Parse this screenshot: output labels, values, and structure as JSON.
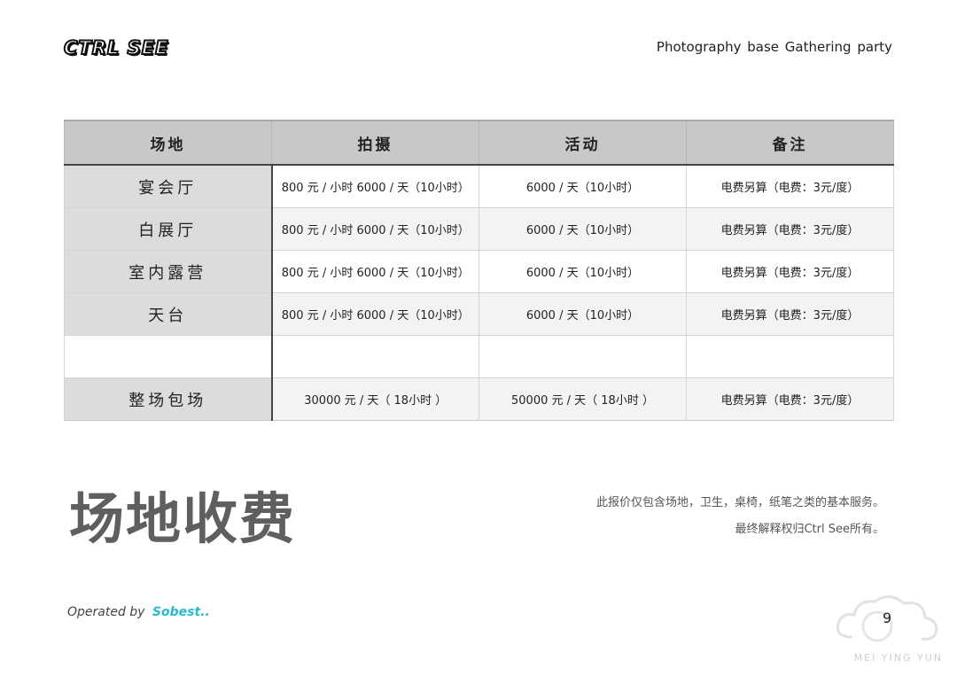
{
  "header": {
    "logo_text": "CTRL SEE",
    "tagline": "Photography base  Gathering party"
  },
  "table": {
    "columns": [
      "场地",
      "拍摄",
      "活动",
      "备注"
    ],
    "rows": [
      {
        "venue": "宴会厅",
        "shoot": "800 元 / 小时   6000 / 天（10小时）",
        "event": "6000 / 天（10小时）",
        "note": "电费另算（电费：3元/度）"
      },
      {
        "venue": "白展厅",
        "shoot": "800 元 / 小时   6000 / 天（10小时）",
        "event": "6000 / 天（10小时）",
        "note": "电费另算（电费：3元/度）"
      },
      {
        "venue": "室内露营",
        "shoot": "800 元 / 小时   6000 / 天（10小时）",
        "event": "6000 / 天（10小时）",
        "note": "电费另算（电费：3元/度）"
      },
      {
        "venue": "天台",
        "shoot": "800 元 / 小时   6000 / 天（10小时）",
        "event": "6000 / 天（10小时）",
        "note": "电费另算（电费：3元/度）"
      },
      {
        "venue": "",
        "shoot": "",
        "event": "",
        "note": ""
      },
      {
        "venue": "整场包场",
        "shoot": "30000 元 / 天（ 18小时 ）",
        "event": "50000 元 / 天（ 18小时 ）",
        "note": "电费另算（电费：3元/度）"
      }
    ]
  },
  "main": {
    "title": "场地收费",
    "note_line1": "此报价仅包含场地，卫生，桌椅，纸笔之类的基本服务。",
    "note_line2": "最终解释权归Ctrl See所有。"
  },
  "footer": {
    "operated_label": "Operated by",
    "brand": "Sobest..",
    "page_number": "9",
    "watermark_text": "MEI YING YUN"
  }
}
